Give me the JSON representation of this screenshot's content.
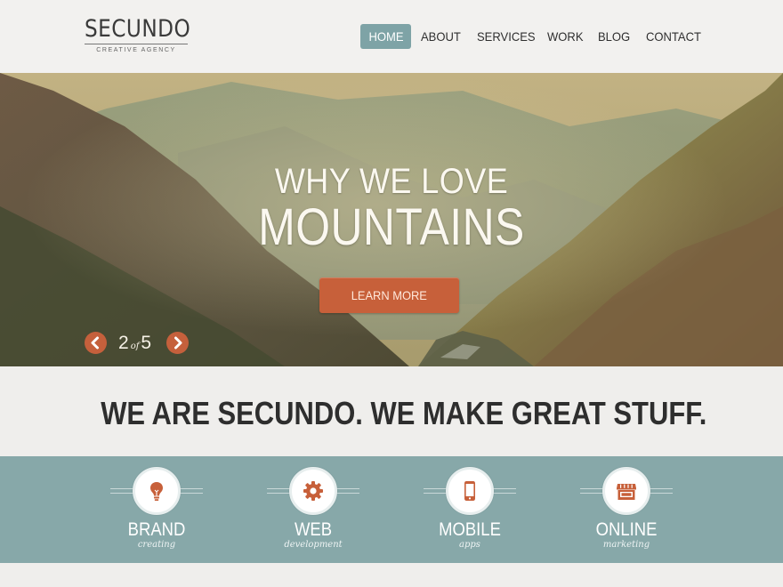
{
  "brand": {
    "name": "SECUNDO",
    "tagline": "CREATIVE AGENCY"
  },
  "nav": {
    "items": [
      {
        "label": "HOME",
        "active": true
      },
      {
        "label": "ABOUT",
        "active": false
      },
      {
        "label": "SERVICES",
        "active": false
      },
      {
        "label": "WORK",
        "active": false
      },
      {
        "label": "BLOG",
        "active": false
      },
      {
        "label": "CONTACT",
        "active": false
      }
    ]
  },
  "hero": {
    "line1": "WHY WE LOVE",
    "line2": "MOUNTAINS",
    "button_label": "LEARN MORE",
    "slider": {
      "current": "2",
      "of": "of",
      "total": "5",
      "prev_icon": "chevron-left-icon",
      "next_icon": "chevron-right-icon"
    }
  },
  "intro": {
    "headline": "WE ARE SECUNDO. WE MAKE GREAT STUFF."
  },
  "services": [
    {
      "title": "BRAND",
      "subtitle": "creating",
      "icon": "lightbulb-icon"
    },
    {
      "title": "WEB",
      "subtitle": "development",
      "icon": "gear-icon"
    },
    {
      "title": "MOBILE",
      "subtitle": "apps",
      "icon": "smartphone-icon"
    },
    {
      "title": "ONLINE",
      "subtitle": "marketing",
      "icon": "storefront-icon"
    }
  ],
  "colors": {
    "accent": "#c7603a",
    "nav_active": "#7ea3a6",
    "services_band": "#87a8a9",
    "background": "#efeeec"
  }
}
